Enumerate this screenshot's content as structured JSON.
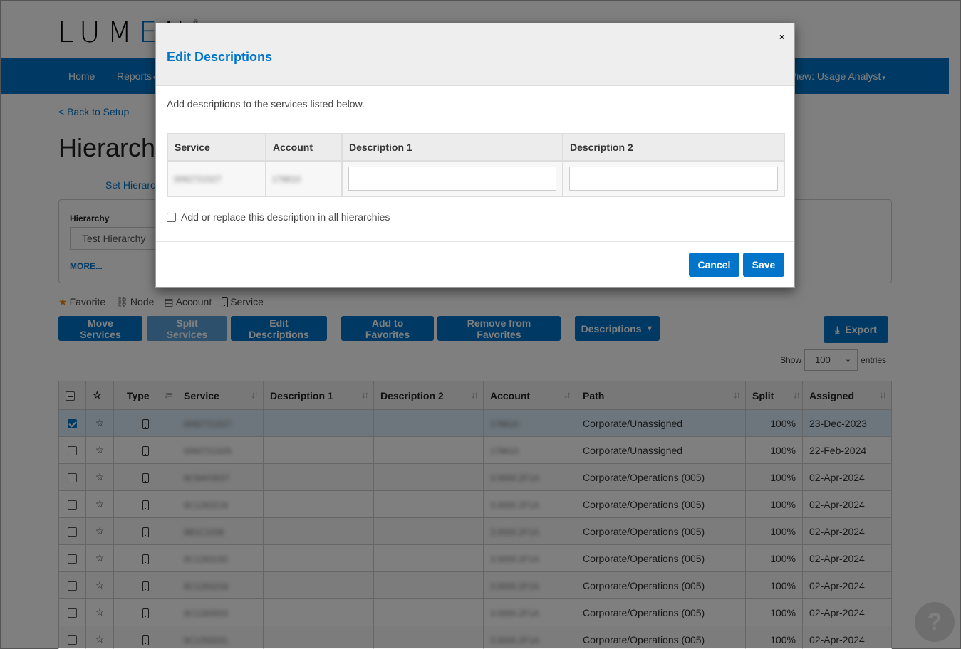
{
  "header": {
    "logo": {
      "pre": "LUM",
      "mid": "E",
      "post": "N",
      "mark": "®"
    },
    "nav": [
      {
        "label": "Home"
      },
      {
        "label": "Reports"
      }
    ],
    "view_label": "View: Usage Analyst"
  },
  "page": {
    "back_link": "< Back to Setup",
    "title": "Hierarchy",
    "set_link": "Set Hierarchy",
    "filter": {
      "hierarchy_label": "Hierarchy",
      "hierarchy_value": "Test Hierarchy",
      "more_label": "MORE..."
    },
    "legend": [
      {
        "icon": "star-icon",
        "label": "Favorite"
      },
      {
        "icon": "node-icon",
        "label": "Node"
      },
      {
        "icon": "document-icon",
        "label": "Account"
      },
      {
        "icon": "mobile-phone-icon",
        "label": "Service"
      }
    ],
    "toolbar": {
      "move_services": "Move Services",
      "split_services": "Split Services",
      "edit_descriptions": "Edit Descriptions",
      "add_favorites": "Add to Favorites",
      "remove_favorites": "Remove from Favorites",
      "descriptions": "Descriptions",
      "export": "Export"
    },
    "show_entries": {
      "show": "Show",
      "value": "100",
      "entries": "entries"
    },
    "table": {
      "columns": [
        "",
        "",
        "Type",
        "Service",
        "Description 1",
        "Description 2",
        "Account",
        "Path",
        "Split",
        "Assigned"
      ],
      "rows": [
        {
          "selected": true,
          "service": "0092721527",
          "desc1": "",
          "desc2": "",
          "account": "178610",
          "path": "Corporate/Unassigned",
          "split": "100%",
          "assigned": "23-Dec-2023"
        },
        {
          "selected": false,
          "service": "0092721526",
          "desc1": "",
          "desc2": "",
          "account": "178610",
          "path": "Corporate/Unassigned",
          "split": "100%",
          "assigned": "22-Feb-2024"
        },
        {
          "selected": false,
          "service": "8C9AF0037",
          "desc1": "",
          "desc2": "",
          "account": "3.0000.2F1A",
          "path": "Corporate/Operations (005)",
          "split": "100%",
          "assigned": "02-Apr-2024"
        },
        {
          "selected": false,
          "service": "8C1283218",
          "desc1": "",
          "desc2": "",
          "account": "3.0000.2F1A",
          "path": "Corporate/Operations (005)",
          "split": "100%",
          "assigned": "02-Apr-2024"
        },
        {
          "selected": false,
          "service": "8B1C1038",
          "desc1": "",
          "desc2": "",
          "account": "3.0000.2F1A",
          "path": "Corporate/Operations (005)",
          "split": "100%",
          "assigned": "02-Apr-2024"
        },
        {
          "selected": false,
          "service": "8C1283192",
          "desc1": "",
          "desc2": "",
          "account": "3.0000.2F1A",
          "path": "Corporate/Operations (005)",
          "split": "100%",
          "assigned": "02-Apr-2024"
        },
        {
          "selected": false,
          "service": "8C1283218",
          "desc1": "",
          "desc2": "",
          "account": "3.0000.2F1A",
          "path": "Corporate/Operations (005)",
          "split": "100%",
          "assigned": "02-Apr-2024"
        },
        {
          "selected": false,
          "service": "8C1283003",
          "desc1": "",
          "desc2": "",
          "account": "3.0000.2F1A",
          "path": "Corporate/Operations (005)",
          "split": "100%",
          "assigned": "02-Apr-2024"
        },
        {
          "selected": false,
          "service": "8C1283201",
          "desc1": "",
          "desc2": "",
          "account": "3.0000.2F1A",
          "path": "Corporate/Operations (005)",
          "split": "100%",
          "assigned": "02-Apr-2024"
        }
      ]
    },
    "help_label": "?"
  },
  "modal": {
    "title": "Edit Descriptions",
    "close_label": "×",
    "intro": "Add descriptions to the services listed below.",
    "table": {
      "headers": [
        "Service",
        "Account",
        "Description 1",
        "Description 2"
      ],
      "row": {
        "service": "0092721527",
        "account": "178610",
        "desc1": "",
        "desc2": ""
      }
    },
    "all_hierarchies_label": "Add or replace this description in all hierarchies",
    "all_hierarchies_checked": false,
    "cancel_label": "Cancel",
    "save_label": "Save"
  },
  "colors": {
    "brand_blue": "#0075c9",
    "overlay": "rgba(0,0,0,0.5)"
  }
}
